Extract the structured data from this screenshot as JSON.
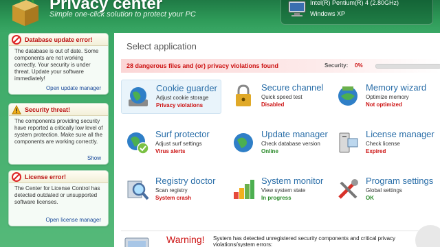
{
  "header": {
    "title": "Privacy center",
    "subtitle": "Simple one-click solution to protect your PC",
    "cpu": "Intel(R) Pentium(R) 4 (2.80GHz)",
    "os": "Windows XP"
  },
  "sidebar": {
    "alerts": [
      {
        "title": "Database update error!",
        "body": "The database is out of date. Some components are not working correctly. Your security is under threat. Update your software immediately!",
        "link": "Open update manager"
      },
      {
        "title": "Security threat!",
        "body": "The components providing security have reported a critically low level of system protection. Make sure all the components are working correctly.",
        "link": "Show"
      },
      {
        "title": "License error!",
        "body": "The Center for License Control has detected outdated or unsupported software licenses.",
        "link": "Open license manager"
      }
    ]
  },
  "main": {
    "section_title": "Select application",
    "threat_message": "28 dangerous files and (or) privacy violations found",
    "security_label": "Security:",
    "security_value": "0%",
    "security_level": 0,
    "tools": [
      {
        "name": "Cookie guarder",
        "desc": "Adjust cookie storage",
        "status": "Privacy violations",
        "status_color": "red",
        "icon": "globe-disk-icon"
      },
      {
        "name": "Secure channel",
        "desc": "Quick speed test",
        "status": "Disabled",
        "status_color": "red",
        "icon": "padlock-icon"
      },
      {
        "name": "Memory wizard",
        "desc": "Optimize memory",
        "status": "Not optimized",
        "status_color": "red",
        "icon": "memory-globe-icon"
      },
      {
        "name": "Surf protector",
        "desc": "Adjust surf settings",
        "status": "Virus alerts",
        "status_color": "red",
        "icon": "globe-shield-icon"
      },
      {
        "name": "Update manager",
        "desc": "Check database version",
        "status": "Online",
        "status_color": "green",
        "icon": "globe-update-icon"
      },
      {
        "name": "License manager",
        "desc": "Check license",
        "status": "Expired",
        "status_color": "red",
        "icon": "license-pc-icon"
      },
      {
        "name": "Registry doctor",
        "desc": "Scan registry",
        "status": "System crash",
        "status_color": "red",
        "icon": "magnifier-icon"
      },
      {
        "name": "System monitor",
        "desc": "View system state",
        "status": "In progress",
        "status_color": "green",
        "icon": "bar-chart-icon"
      },
      {
        "name": "Program settings",
        "desc": "Global settings",
        "status": "OK",
        "status_color": "green",
        "icon": "tools-icon"
      }
    ],
    "warning": {
      "title": "Warning!",
      "text": "System has detected unregistered security components and critical privacy violations/system errors:"
    }
  },
  "colors": {
    "brand_green": "#2e9a58",
    "alert_red": "#cc1111",
    "ok_green": "#2a8a2a",
    "link_blue": "#2a6ea8"
  }
}
